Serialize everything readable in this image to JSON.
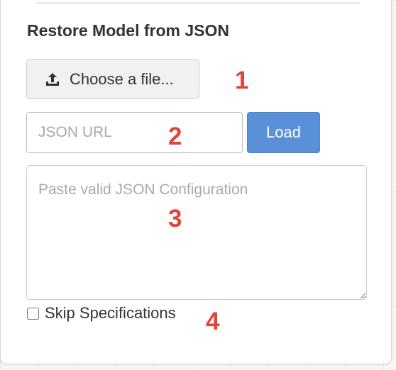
{
  "panel": {
    "title": "Restore Model from JSON",
    "file_button": {
      "label": "Choose a file...",
      "icon": "upload-icon"
    },
    "url_input": {
      "placeholder": "JSON URL",
      "value": ""
    },
    "load_button": {
      "label": "Load"
    },
    "json_textarea": {
      "placeholder": "Paste valid JSON Configuration",
      "value": ""
    },
    "skip_specifications": {
      "label": "Skip Specifications",
      "checked": false
    }
  },
  "annotations": [
    "1",
    "2",
    "3",
    "4"
  ],
  "colors": {
    "accent": "#5990d8",
    "annotation": "#e0453a"
  }
}
